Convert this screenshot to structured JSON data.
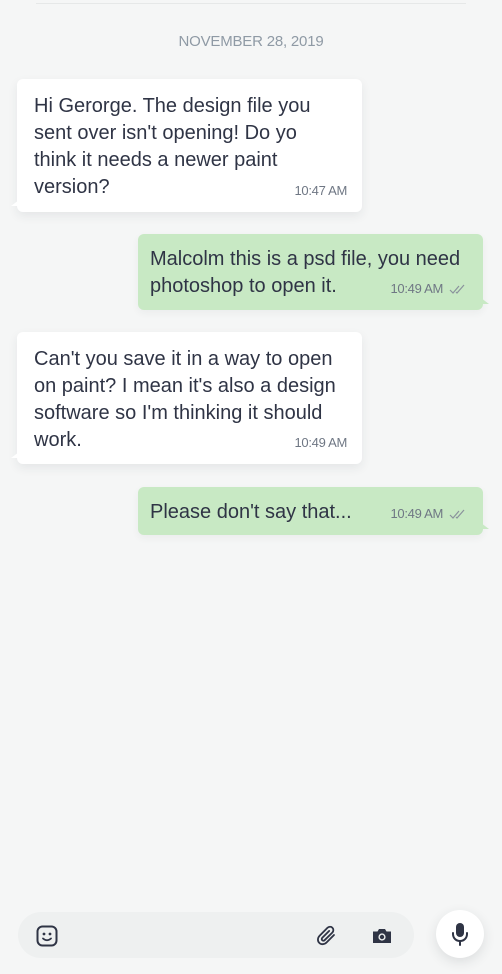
{
  "conversation": {
    "date": "NOVEMBER 28, 2019",
    "messages": [
      {
        "direction": "incoming",
        "text": "Hi Gerorge. The design file you sent over isn't opening! Do yo think it needs a newer paint version?",
        "time": "10:47 AM"
      },
      {
        "direction": "outgoing",
        "text": "Malcolm this is a psd file, you need photoshop to open it.",
        "time": "10:49 AM",
        "status_icon": "double-check-icon"
      },
      {
        "direction": "incoming",
        "text": "Can't you save it in a way to open on paint? I mean it's also a design software so I'm thinking  it should work.",
        "time": "10:49 AM"
      },
      {
        "direction": "outgoing",
        "text": "Please don't say that...",
        "time": "10:49 AM",
        "status_icon": "double-check-icon"
      }
    ]
  },
  "composer": {
    "icons": [
      "emoji-icon",
      "paperclip-icon",
      "camera-icon",
      "microphone-icon"
    ]
  },
  "colors": {
    "background": "#f5f6f6",
    "incoming_bubble": "#ffffff",
    "outgoing_bubble": "#c8e9c4",
    "text": "#2f3445",
    "meta_text": "#6f7784"
  }
}
